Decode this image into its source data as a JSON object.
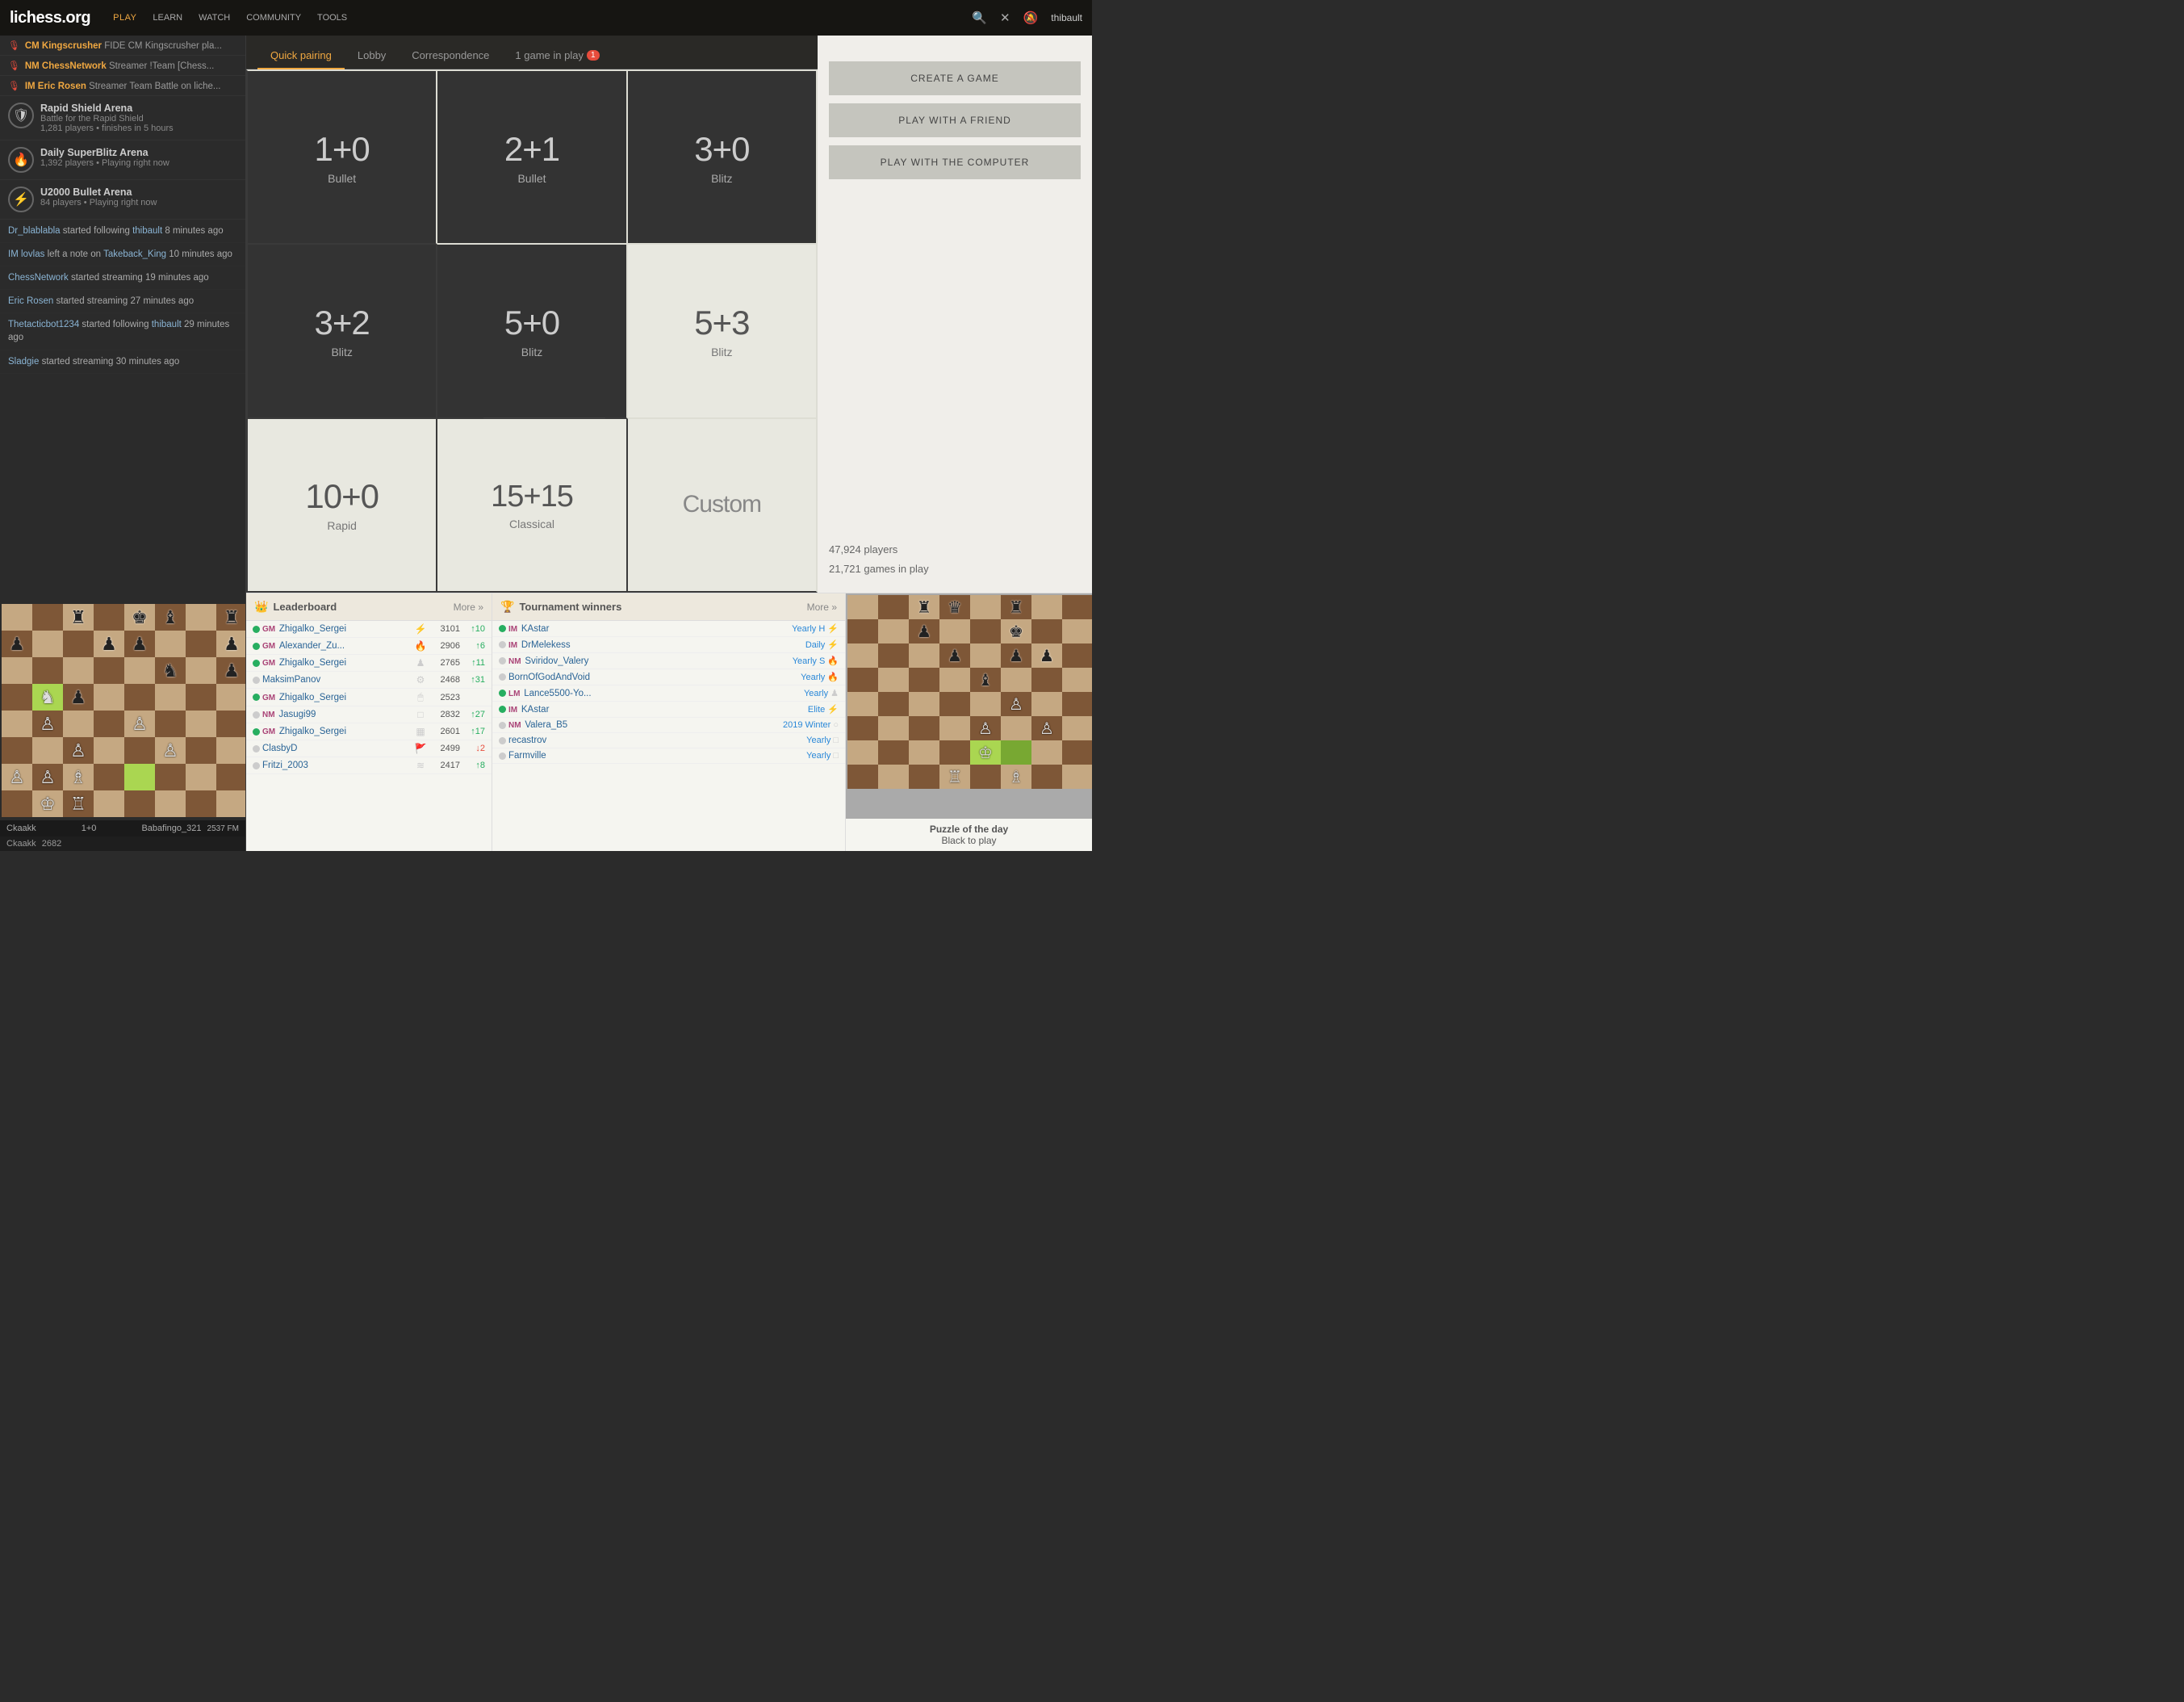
{
  "nav": {
    "logo": "lichess.org",
    "links": [
      "PLAY",
      "LEARN",
      "WATCH",
      "COMMUNITY",
      "TOOLS"
    ],
    "user": "thibault",
    "search_icon": "🔍",
    "close_icon": "✕",
    "bell_icon": "🔔"
  },
  "sidebar": {
    "streamers": [
      {
        "title": "CM Kingscrusher",
        "suffix": "FIDE CM Kingscrusher pla...",
        "icon": "🎙"
      },
      {
        "title": "NM ChessNetwork",
        "suffix": "Streamer !Team [Chess...",
        "icon": "🎙"
      },
      {
        "title": "IM Eric Rosen",
        "suffix": "Streamer Team Battle on liche...",
        "icon": "🎙"
      }
    ],
    "tournaments": [
      {
        "name": "Rapid Shield Arena",
        "sub1": "Battle for the Rapid Shield",
        "sub2": "1,281 players • finishes in 5 hours",
        "icon": "🛡"
      },
      {
        "name": "Daily SuperBlitz Arena",
        "sub1": "1,392 players • Playing right now",
        "icon": "🔥"
      },
      {
        "name": "U2000 Bullet Arena",
        "sub1": "84 players • Playing right now",
        "icon": "⚡"
      }
    ],
    "activities": [
      {
        "text": "Dr_blablabla started following thibault 8 minutes ago",
        "user1": "Dr_blablabla",
        "link": "thibault"
      },
      {
        "text": "IM lovlas left a note on Takeback_King 10 minutes ago",
        "user1": "IM lovlas",
        "link": "Takeback_King"
      },
      {
        "text": "ChessNetwork started streaming 19 minutes ago",
        "user1": "ChessNetwork"
      },
      {
        "text": "Eric Rosen started streaming 27 minutes ago",
        "user1": "Eric Rosen"
      },
      {
        "text": "Thetacticbot1234 started following thibault 29 minutes ago",
        "user1": "Thetacticbot1234",
        "link": "thibault"
      },
      {
        "text": "Sladgie started streaming 30 minutes ago",
        "user1": "Sladgie"
      }
    ],
    "bottom_board": {
      "white": "Babafingo_321",
      "white_rating": "2537 FM",
      "black": "Ckaakk",
      "black_rating": "2682",
      "time_control": "1+0"
    }
  },
  "tabs": [
    {
      "label": "Quick pairing",
      "active": true
    },
    {
      "label": "Lobby",
      "active": false
    },
    {
      "label": "Correspondence",
      "active": false
    },
    {
      "label": "1 game in play",
      "active": false,
      "badge": "1"
    }
  ],
  "game_grid": [
    {
      "time": "1+0",
      "variant": "Bullet",
      "theme": "dark"
    },
    {
      "time": "2+1",
      "variant": "Bullet",
      "theme": "dark"
    },
    {
      "time": "3+0",
      "variant": "Blitz",
      "theme": "dark"
    },
    {
      "time": "3+2",
      "variant": "Blitz",
      "theme": "dark"
    },
    {
      "time": "5+0",
      "variant": "Blitz",
      "theme": "dark"
    },
    {
      "time": "5+3",
      "variant": "Blitz",
      "theme": "light"
    },
    {
      "time": "10+0",
      "variant": "Rapid",
      "theme": "light"
    },
    {
      "time": "15+15",
      "variant": "Classical",
      "theme": "light"
    },
    {
      "time": "Custom",
      "variant": "",
      "theme": "light",
      "custom": true
    }
  ],
  "right_sidebar": {
    "buttons": [
      {
        "label": "CREATE A GAME"
      },
      {
        "label": "PLAY WITH A FRIEND"
      },
      {
        "label": "PLAY WITH THE COMPUTER"
      }
    ],
    "stats": {
      "players": "47,924 players",
      "games": "21,721 games in play"
    }
  },
  "leaderboard": {
    "title": "Leaderboard",
    "more": "More »",
    "rows": [
      {
        "title": "GM",
        "name": "Zhigalko_Sergei",
        "icon": "⚡",
        "rating": "3101",
        "trend": "↑10",
        "online": true
      },
      {
        "title": "GM",
        "name": "Alexander_Zu...",
        "icon": "🔥",
        "rating": "2906",
        "trend": "↑6",
        "online": true
      },
      {
        "title": "GM",
        "name": "Zhigalko_Sergei",
        "icon": "♟",
        "rating": "2765",
        "trend": "↑11",
        "online": true
      },
      {
        "title": "",
        "name": "MaksimPanov",
        "icon": "⚙",
        "rating": "2468",
        "trend": "↑31",
        "online": false
      },
      {
        "title": "GM",
        "name": "Zhigalko_Sergei",
        "icon": "🖱",
        "rating": "2523",
        "trend": "",
        "online": true
      },
      {
        "title": "NM",
        "name": "Jasugi99",
        "icon": "□",
        "rating": "2832",
        "trend": "↑27",
        "online": false
      },
      {
        "title": "GM",
        "name": "Zhigalko_Sergei",
        "icon": "▦",
        "rating": "2601",
        "trend": "↑17",
        "online": true
      },
      {
        "title": "",
        "name": "ClasbyD",
        "icon": "🚩",
        "rating": "2499",
        "trend": "↓2",
        "neg": true,
        "online": false
      },
      {
        "title": "",
        "name": "Fritzi_2003",
        "icon": "≋",
        "rating": "2417",
        "trend": "↑8",
        "online": false
      }
    ]
  },
  "tournament_winners": {
    "title": "Tournament winners",
    "more": "More »",
    "rows": [
      {
        "title": "IM",
        "name": "KAstar",
        "period": "Yearly H",
        "icon": "⚡",
        "online": true
      },
      {
        "title": "IM",
        "name": "DrMelekess",
        "period": "Daily",
        "icon": "⚡",
        "online": false
      },
      {
        "title": "NM",
        "name": "Sviridov_Valery",
        "period": "Yearly S",
        "icon": "🔥",
        "online": false
      },
      {
        "title": "",
        "name": "BornOfGodAndVoid",
        "period": "Yearly",
        "icon": "🔥",
        "online": false
      },
      {
        "title": "LM",
        "name": "Lance5500-Yo...",
        "period": "Yearly",
        "icon": "♟",
        "online": true
      },
      {
        "title": "IM",
        "name": "KAstar",
        "period": "Elite",
        "icon": "⚡",
        "online": true
      },
      {
        "title": "NM",
        "name": "Valera_B5",
        "period": "2019 Winter",
        "icon": "○",
        "online": false
      },
      {
        "title": "",
        "name": "recastrov",
        "period": "Yearly",
        "icon": "□",
        "online": false
      },
      {
        "title": "",
        "name": "Farmville",
        "period": "Yearly",
        "icon": "□",
        "online": false
      }
    ]
  },
  "puzzle": {
    "title": "Puzzle of the day",
    "sub": "Black to play"
  }
}
